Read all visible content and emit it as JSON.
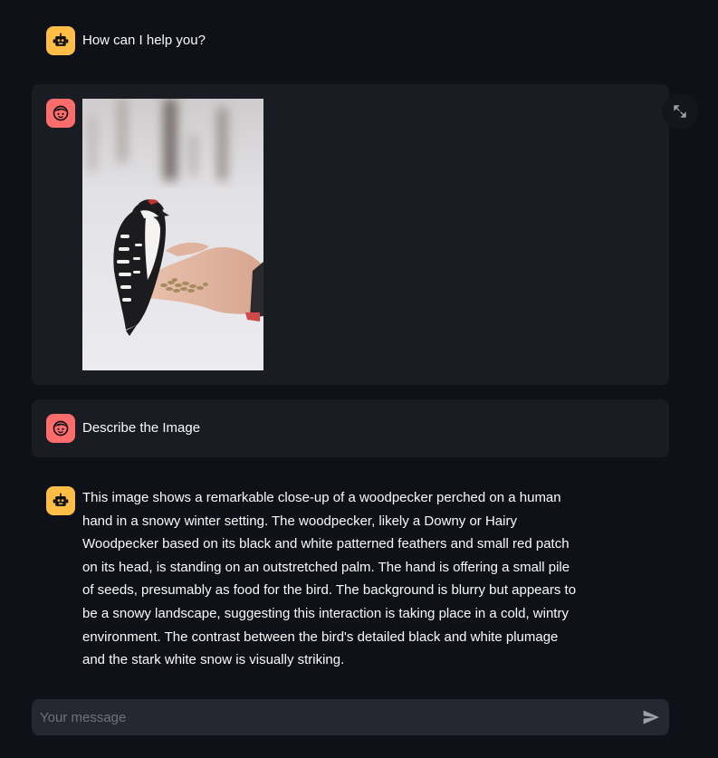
{
  "colors": {
    "background": "#0e1117",
    "user_message_bg": "#1a1c24",
    "bot_avatar": "#ffbd45",
    "user_avatar": "#ff6c6c",
    "input_bg": "#262730"
  },
  "messages": [
    {
      "role": "assistant",
      "avatar_icon": "robot-icon",
      "text": "How can I help you?"
    },
    {
      "role": "user",
      "avatar_icon": "face-icon",
      "image": "woodpecker-on-hand-photo"
    },
    {
      "role": "user",
      "avatar_icon": "face-icon",
      "text": "Describe the Image"
    },
    {
      "role": "assistant",
      "avatar_icon": "robot-icon",
      "lines": [
        "This image shows a remarkable close-up of a woodpecker perched on a human",
        "hand in a snowy winter setting. The woodpecker, likely a Downy or Hairy",
        "Woodpecker based on its black and white patterned feathers and small red patch",
        "on its head, is standing on an outstretched palm. The hand is offering a small pile",
        "of seeds, presumably as food for the bird. The background is blurry but appears to",
        "be a snowy landscape, suggesting this interaction is taking place in a cold, wintry",
        "environment. The contrast between the bird's detailed black and white plumage",
        "and the stark white snow is visually striking."
      ]
    }
  ],
  "image_toolbar": {
    "icon": "fullscreen-icon"
  },
  "chat_input": {
    "placeholder": "Your message",
    "value": "",
    "send_icon": "send-icon"
  }
}
